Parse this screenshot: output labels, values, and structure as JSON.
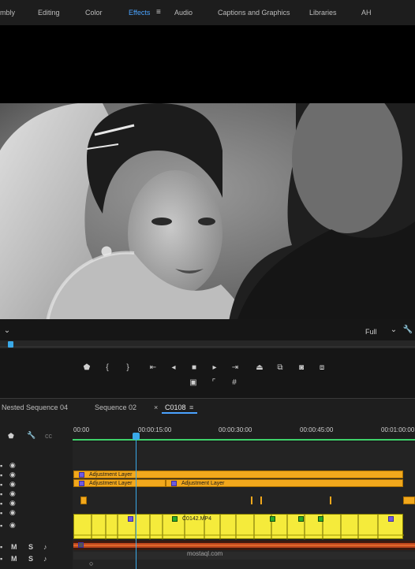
{
  "workspace": {
    "tabs": [
      "mbly",
      "Editing",
      "Color",
      "Effects",
      "Audio",
      "Captions and Graphics",
      "Libraries",
      "AH"
    ],
    "active": "Effects"
  },
  "monitor": {
    "zoom_level": "Full"
  },
  "timeline": {
    "tabs": [
      "Nested Sequence 04",
      "Sequence 02",
      "C0108"
    ],
    "active_tab": "C0108",
    "ruler_labels": [
      "00:00",
      "00:00:15:00",
      "00:00:30:00",
      "00:00:45:00",
      "00:01:00:00"
    ],
    "clips": {
      "adjustment_1": "Adjustment Layer",
      "adjustment_2": "Adjustment Layer",
      "adjustment_3": "Adjustment Layer",
      "video_main": "C0142.MP4"
    },
    "audio_track_buttons": [
      "M",
      "S",
      "M",
      "S"
    ]
  },
  "watermark": {
    "site": "mostaql.com"
  },
  "colors": {
    "accent": "#4aa3ff",
    "adjustment_clip": "#f2a81c",
    "video_clip": "#f5eb3b",
    "audio_clip": "#c0471e",
    "playhead": "#3aa9e8"
  }
}
